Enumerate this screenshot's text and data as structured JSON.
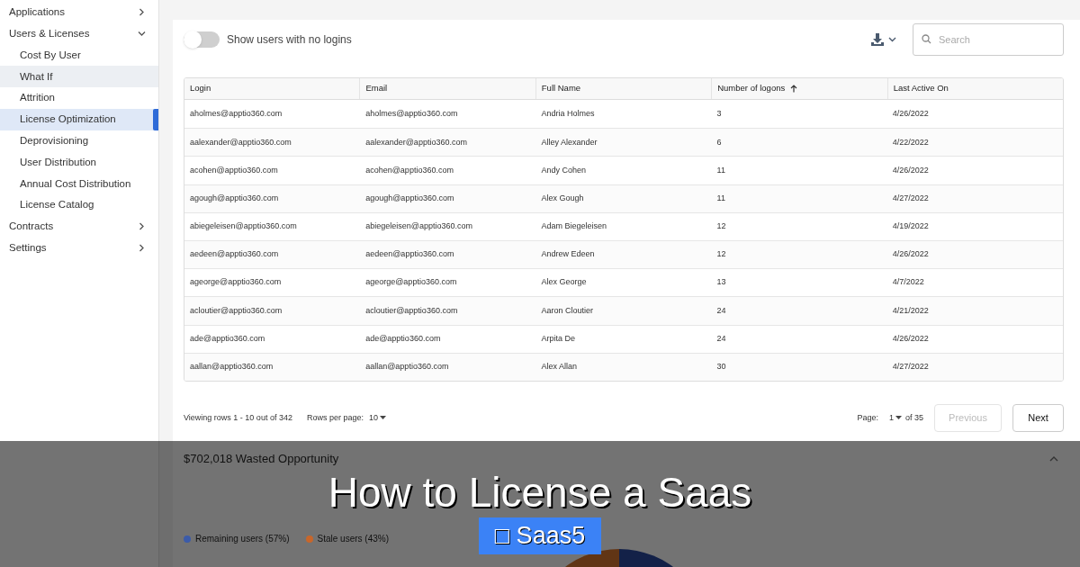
{
  "sidebar": {
    "items": [
      {
        "label": "Applications",
        "expanded": false,
        "selected": false,
        "hovered": false
      },
      {
        "label": "Users & Licenses",
        "expanded": true,
        "selected": false,
        "hovered": false,
        "children": [
          {
            "label": "Cost By User",
            "selected": false,
            "hovered": false
          },
          {
            "label": "What If",
            "selected": false,
            "hovered": true
          },
          {
            "label": "Attrition",
            "selected": false,
            "hovered": false
          },
          {
            "label": "License Optimization",
            "selected": true,
            "hovered": false
          },
          {
            "label": "Deprovisioning",
            "selected": false,
            "hovered": false
          },
          {
            "label": "User Distribution",
            "selected": false,
            "hovered": false
          },
          {
            "label": "Annual Cost Distribution",
            "selected": false,
            "hovered": false
          },
          {
            "label": "License Catalog",
            "selected": false,
            "hovered": false
          }
        ]
      },
      {
        "label": "Contracts",
        "expanded": false,
        "selected": false,
        "hovered": false
      },
      {
        "label": "Settings",
        "expanded": false,
        "selected": false,
        "hovered": false
      }
    ]
  },
  "toolbar": {
    "toggle": {
      "label": "Show users with no logins",
      "on": false
    },
    "search": {
      "placeholder": "Search"
    }
  },
  "table": {
    "columns": [
      {
        "label": "Login",
        "sorted": false
      },
      {
        "label": "Email",
        "sorted": false
      },
      {
        "label": "Full Name",
        "sorted": false
      },
      {
        "label": "Number of logons",
        "sorted": true
      },
      {
        "label": "Last Active On",
        "sorted": false
      }
    ],
    "rows": [
      [
        "aholmes@apptio360.com",
        "aholmes@apptio360.com",
        "Andria Holmes",
        "3",
        "4/26/2022"
      ],
      [
        "aalexander@apptio360.com",
        "aalexander@apptio360.com",
        "Alley Alexander",
        "6",
        "4/22/2022"
      ],
      [
        "acohen@apptio360.com",
        "acohen@apptio360.com",
        "Andy Cohen",
        "11",
        "4/26/2022"
      ],
      [
        "agough@apptio360.com",
        "agough@apptio360.com",
        "Alex Gough",
        "11",
        "4/27/2022"
      ],
      [
        "abiegeleisen@apptio360.com",
        "abiegeleisen@apptio360.com",
        "Adam Biegeleisen",
        "12",
        "4/19/2022"
      ],
      [
        "aedeen@apptio360.com",
        "aedeen@apptio360.com",
        "Andrew Edeen",
        "12",
        "4/26/2022"
      ],
      [
        "ageorge@apptio360.com",
        "ageorge@apptio360.com",
        "Alex George",
        "13",
        "4/7/2022"
      ],
      [
        "acloutier@apptio360.com",
        "acloutier@apptio360.com",
        "Aaron Cloutier",
        "24",
        "4/21/2022"
      ],
      [
        "ade@apptio360.com",
        "ade@apptio360.com",
        "Arpita De",
        "24",
        "4/26/2022"
      ],
      [
        "aallan@apptio360.com",
        "aallan@apptio360.com",
        "Alex Allan",
        "30",
        "4/27/2022"
      ]
    ]
  },
  "pagination": {
    "viewing": "Viewing rows 1 - 10 out of 342",
    "rows_per_page_label": "Rows per page:",
    "rows_per_page": "10",
    "page_label": "Page:",
    "page": "1",
    "of": "of 35",
    "previous": {
      "label": "Previous",
      "disabled": true
    },
    "next": {
      "label": "Next",
      "disabled": false
    }
  },
  "wasted_section": {
    "title": "$702,018 Wasted Opportunity",
    "legend": [
      {
        "label": "Remaining users (57%)",
        "color": "#3b5ba9"
      },
      {
        "label": "Stale users (43%)",
        "color": "#c8662a"
      }
    ]
  },
  "banner": {
    "title": "How to License a Saas",
    "badge": "□ Saas5"
  }
}
